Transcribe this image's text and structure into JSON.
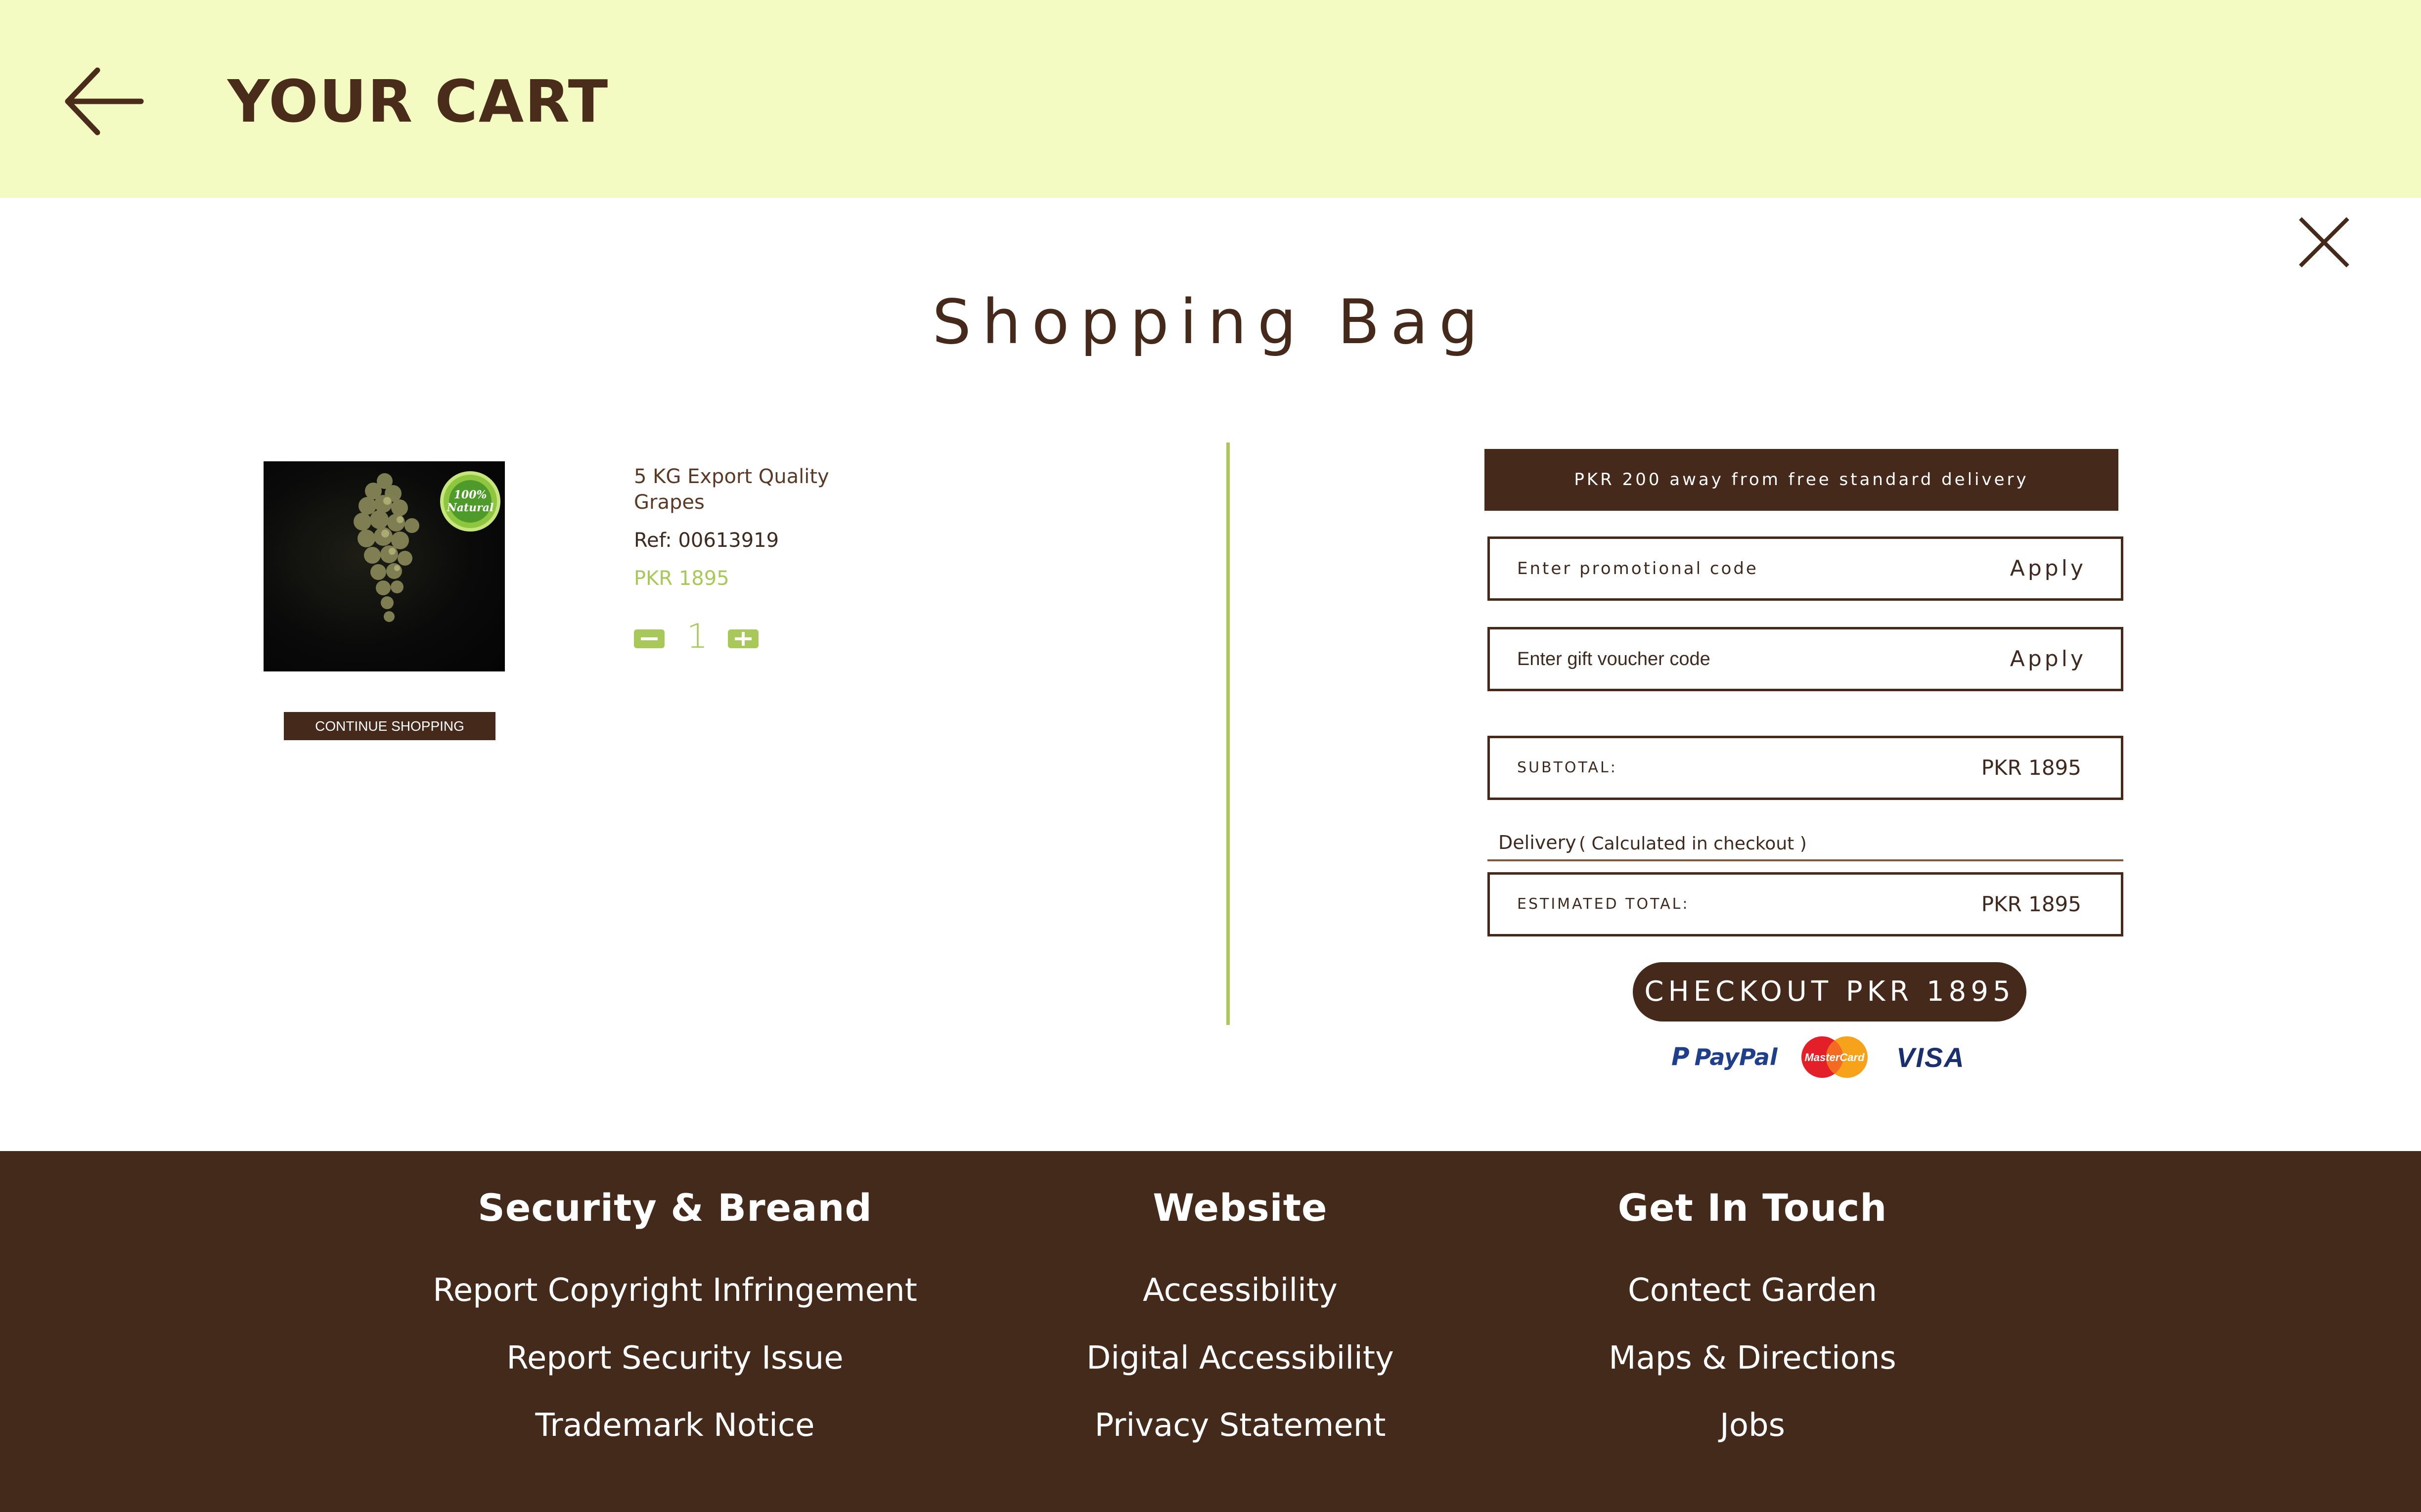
{
  "header": {
    "title": "YOUR CART",
    "back_icon": "arrow-left-icon",
    "background": "#f3fac2"
  },
  "close_icon": "close-x-icon",
  "page_title": "Shopping Bag",
  "cart": {
    "items": [
      {
        "name": "5 KG Export Quality Grapes",
        "ref": "Ref: 00613919",
        "price": "PKR 1895",
        "quantity": "1",
        "badge_text": [
          "100%",
          "Natural"
        ]
      }
    ],
    "continue_label": "CONTINUE SHOPPING"
  },
  "summary": {
    "delivery_banner": "PKR 200 away from free standard delivery",
    "promo_placeholder": "Enter promotional code",
    "promo_apply": "Apply",
    "voucher_placeholder": "Enter gift voucher code",
    "voucher_apply": "Apply",
    "subtotal_label": "SUBTOTAL:",
    "subtotal_value": "PKR 1895",
    "delivery_label": "Delivery",
    "delivery_note": "( Calculated in checkout )",
    "estimated_label": "ESTIMATED TOTAL:",
    "estimated_value": "PKR 1895",
    "checkout_label": "CHECKOUT   PKR 1895",
    "payment_methods": [
      "PayPal",
      "MasterCard",
      "VISA"
    ]
  },
  "footer": {
    "columns": [
      {
        "heading": "Security & Breand",
        "links": [
          "Report Copyright Infringement",
          "Report Security Issue",
          "Trademark Notice"
        ]
      },
      {
        "heading": "Website",
        "links": [
          "Accessibility",
          "Digital Accessibility",
          "Privacy Statement"
        ]
      },
      {
        "heading": "Get In Touch",
        "links": [
          "Contect Garden",
          "Maps & Directions",
          "Jobs"
        ]
      }
    ]
  },
  "colors": {
    "brand_brown": "#45291a",
    "accent_green": "#a8c85a",
    "header_bg": "#f3fac2"
  }
}
